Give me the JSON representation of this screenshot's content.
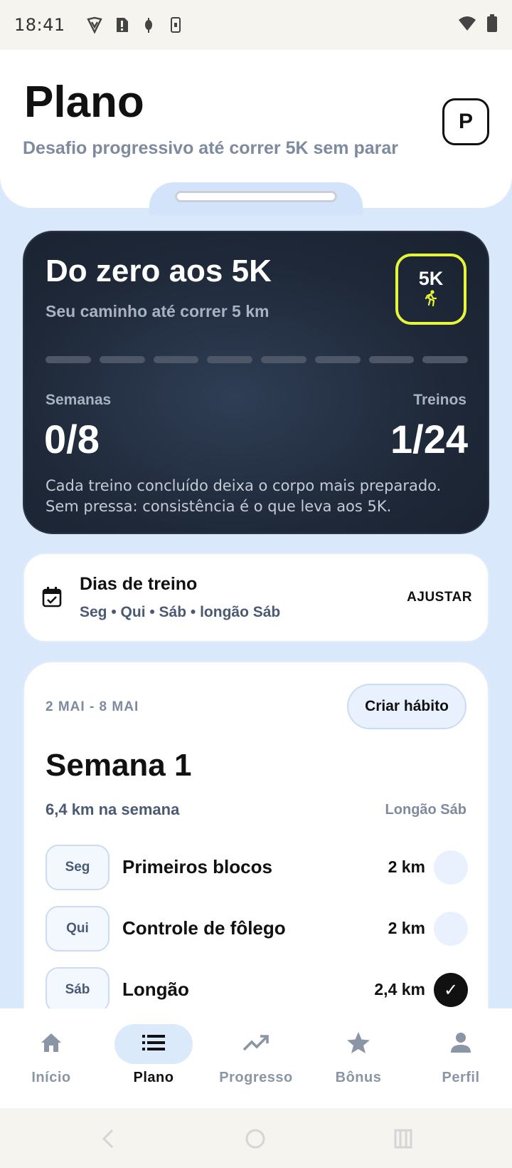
{
  "status_bar": {
    "time": "18:41"
  },
  "header": {
    "title": "Plano",
    "subtitle": "Desafio progressivo até correr 5K sem parar",
    "avatar_letter": "P"
  },
  "hero": {
    "title": "Do zero aos 5K",
    "subtitle": "Seu caminho até correr 5 km",
    "badge": "5K",
    "weeks_label": "Semanas",
    "weeks_value": "0/8",
    "workouts_label": "Treinos",
    "workouts_value": "1/24",
    "note_line1": "Cada treino concluído deixa o corpo mais preparado.",
    "note_line2": "Sem pressa: consistência é o que leva aos 5K.",
    "weeks_completed": 0,
    "weeks_total": 8
  },
  "training_days": {
    "title": "Dias de treino",
    "days": "Seg • Qui • Sáb • longão Sáb",
    "action": "AJUSTAR"
  },
  "week": {
    "range": "2 MAI - 8 MAI",
    "habit_button": "Criar hábito",
    "title": "Semana 1",
    "distance": "6,4 km na semana",
    "long_run": "Longão Sáb",
    "workouts": [
      {
        "day": "Seg",
        "name": "Primeiros blocos",
        "distance": "2 km",
        "done": false
      },
      {
        "day": "Qui",
        "name": "Controle de fôlego",
        "distance": "2 km",
        "done": false
      },
      {
        "day": "Sáb",
        "name": "Longão",
        "distance": "2,4 km",
        "done": true
      }
    ],
    "check_glyph": "✓"
  },
  "bottom_nav": {
    "items": [
      {
        "label": "Início",
        "icon": "home-icon"
      },
      {
        "label": "Plano",
        "icon": "list-icon",
        "active": true
      },
      {
        "label": "Progresso",
        "icon": "trending-up-icon"
      },
      {
        "label": "Bônus",
        "icon": "star-icon"
      },
      {
        "label": "Perfil",
        "icon": "person-icon"
      }
    ]
  },
  "colors": {
    "accent_yellow": "#e6f53a",
    "hero_bg": "#1e2838",
    "page_bg": "#d9e8fb"
  }
}
